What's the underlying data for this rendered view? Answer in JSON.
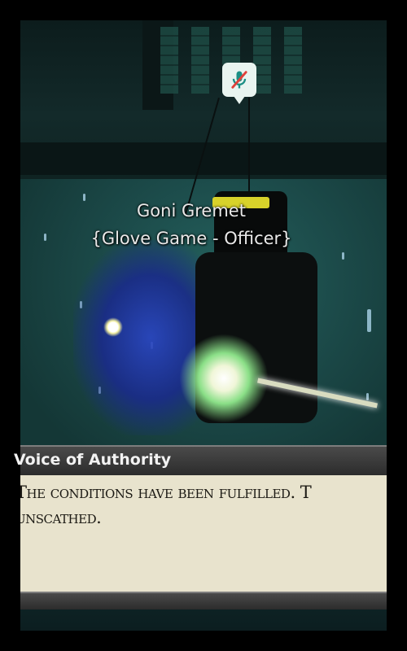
{
  "scene": {
    "speech_bubble_icon": "muted-microphone-icon",
    "nametag": {
      "player_name": "Goni Gremet",
      "team": "{Glove Game - Officer}"
    }
  },
  "dialog": {
    "speaker": "Voice of Authority",
    "message": "The conditions have been fulfilled. T\nunscathed."
  },
  "colors": {
    "dialog_bg": "#e8e3cd",
    "dialog_bar": "#3a3a3a",
    "muted_icon": "#e0403a"
  }
}
